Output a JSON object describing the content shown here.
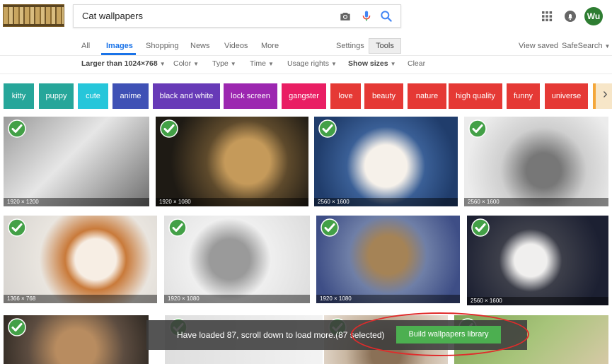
{
  "search": {
    "query": "Cat wallpapers"
  },
  "header": {
    "avatar_text": "Wu",
    "icons": [
      "camera-icon",
      "mic-icon",
      "search-icon",
      "apps-icon",
      "notifications-icon"
    ]
  },
  "nav": {
    "tabs": [
      "All",
      "Images",
      "Shopping",
      "News",
      "Videos",
      "More"
    ],
    "active_tab": "Images",
    "settings": "Settings",
    "tools": "Tools",
    "view_saved": "View saved",
    "safesearch": "SafeSearch"
  },
  "filters": {
    "size": "Larger than 1024×768",
    "color": "Color",
    "type": "Type",
    "time": "Time",
    "usage": "Usage rights",
    "show_sizes": "Show sizes",
    "clear": "Clear"
  },
  "chips": [
    {
      "label": "kitty",
      "color": "#26a69a"
    },
    {
      "label": "puppy",
      "color": "#26a69a"
    },
    {
      "label": "cute",
      "color": "#26c6da"
    },
    {
      "label": "anime",
      "color": "#3f51b5"
    },
    {
      "label": "black and white",
      "color": "#673ab7"
    },
    {
      "label": "lock screen",
      "color": "#9c27b0"
    },
    {
      "label": "gangster",
      "color": "#e91e63"
    },
    {
      "label": "love",
      "color": "#e53935"
    },
    {
      "label": "beauty",
      "color": "#e53935"
    },
    {
      "label": "nature",
      "color": "#e53935"
    },
    {
      "label": "high quality",
      "color": "#e53935"
    },
    {
      "label": "funny",
      "color": "#e53935"
    },
    {
      "label": "universe",
      "color": "#e53935"
    }
  ],
  "images": [
    {
      "res": "1920 × 1200"
    },
    {
      "res": "1920 × 1080"
    },
    {
      "res": "2560 × 1600"
    },
    {
      "res": "2560 × 1600"
    },
    {
      "res": "1366 × 768"
    },
    {
      "res": "1920 × 1080"
    },
    {
      "res": "1920 × 1080"
    },
    {
      "res": "2560 × 1600"
    },
    {
      "res": ""
    },
    {
      "res": ""
    },
    {
      "res": ""
    },
    {
      "res": ""
    }
  ],
  "loader": {
    "message": "Have loaded 87,  scroll down to load more.(87 selected)",
    "build_button": "Build wallpapers library"
  },
  "colors": {
    "accent_blue": "#1a73e8",
    "check_green": "#43a047",
    "build_green": "#4caf50",
    "highlight_red": "#e02b2b"
  }
}
